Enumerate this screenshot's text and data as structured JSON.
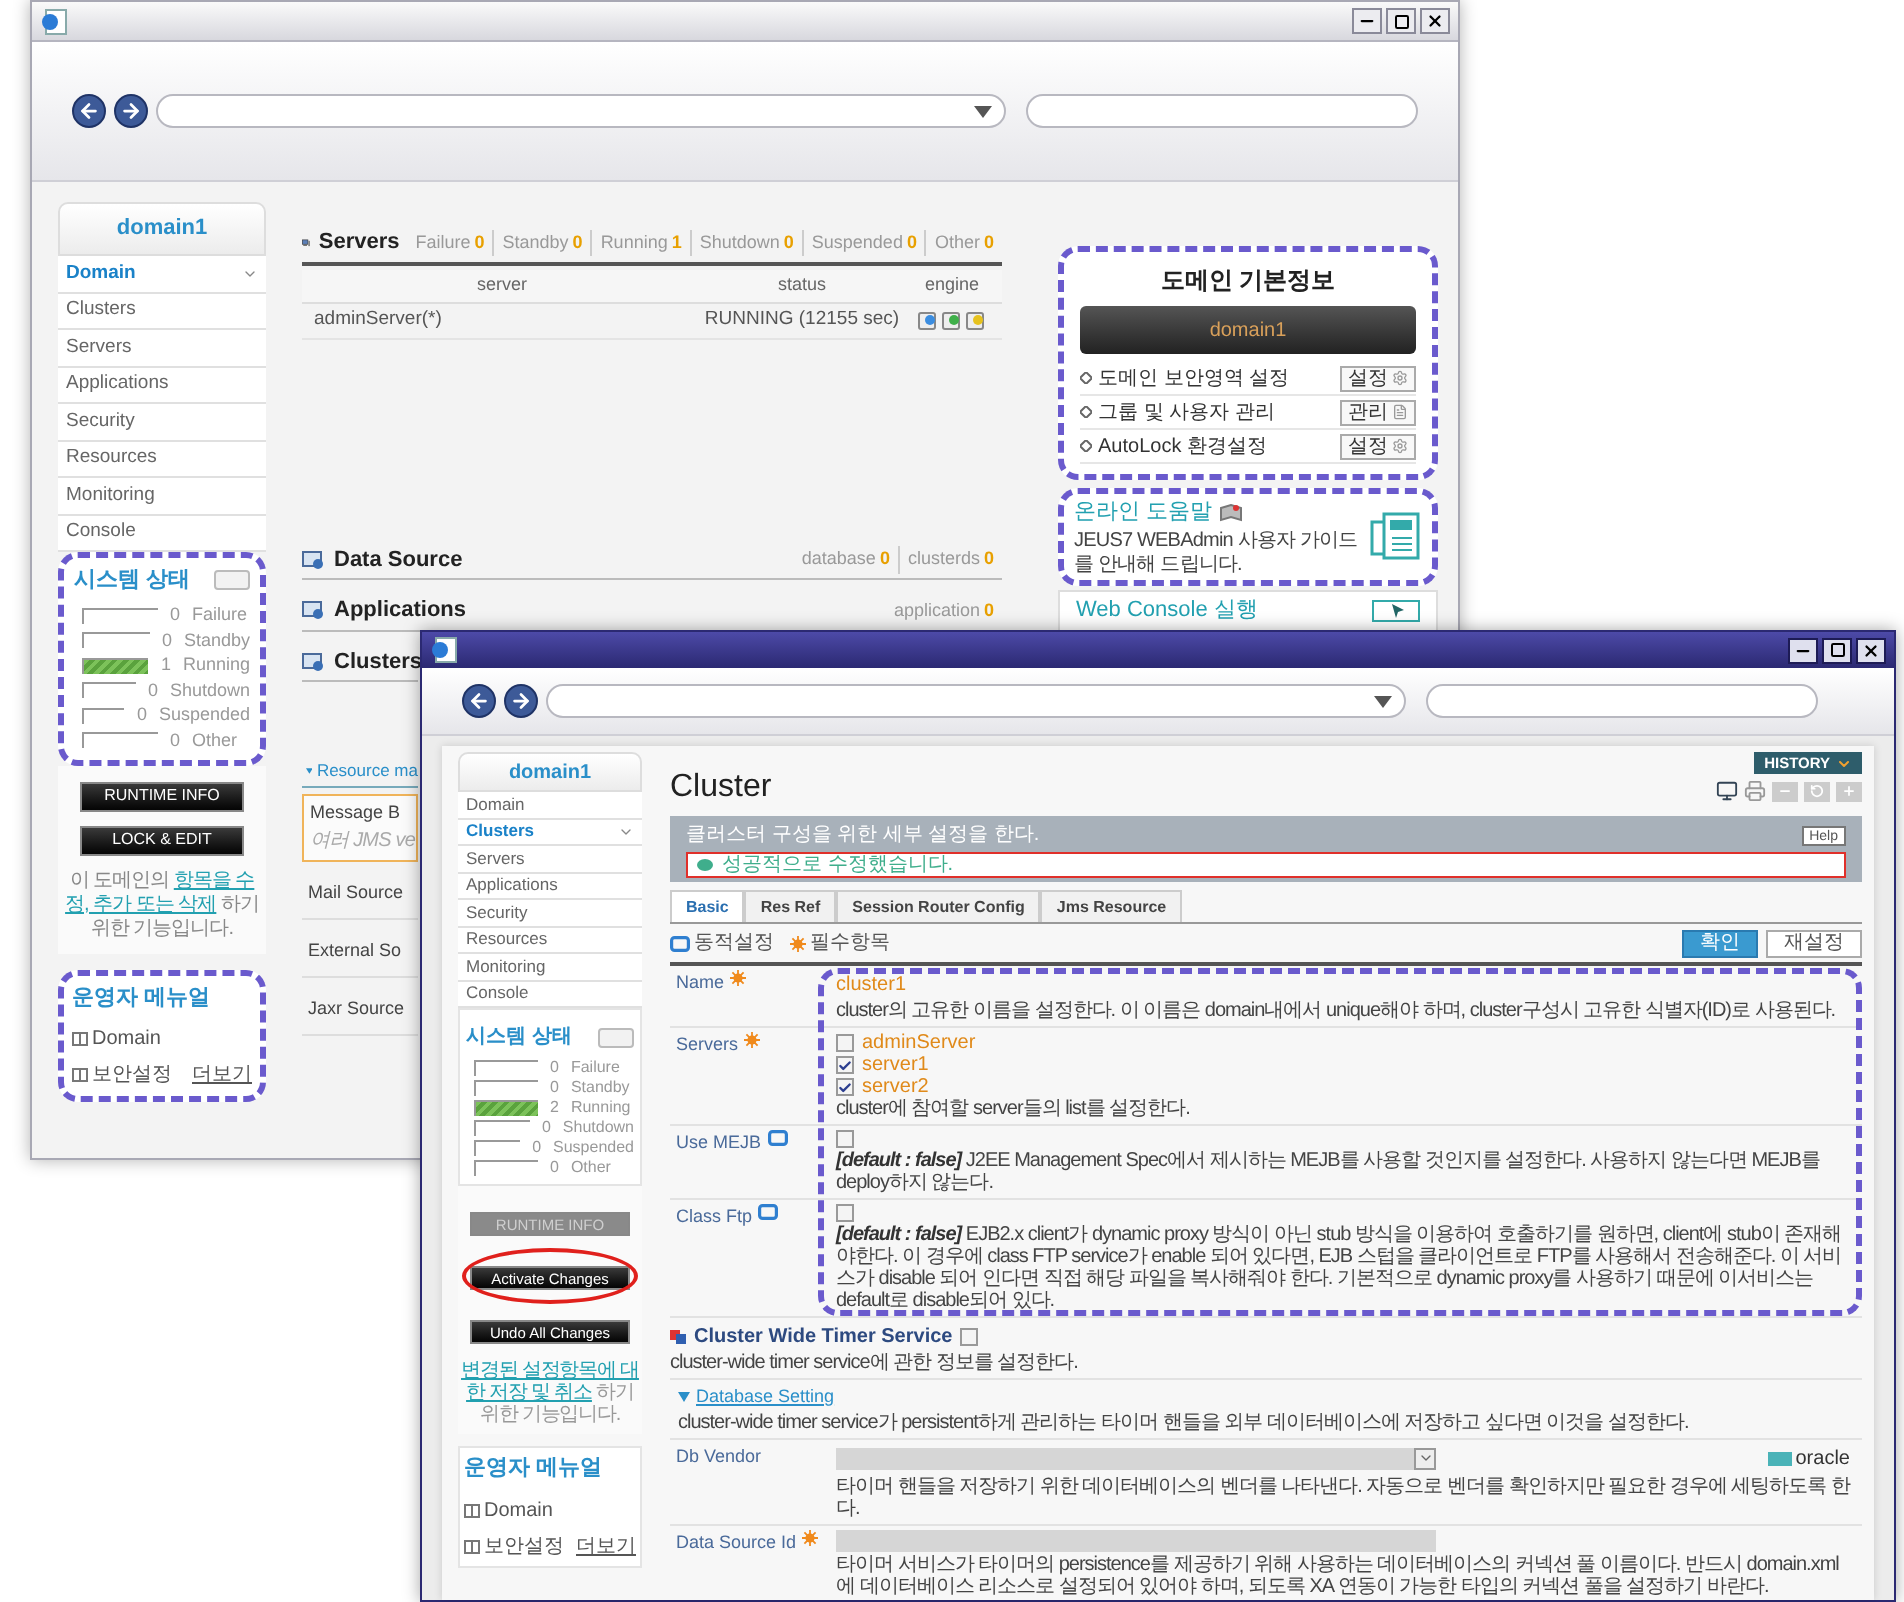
{
  "back_window": {
    "sidebar": {
      "domain": "domain1",
      "items": [
        {
          "label": "Domain",
          "selected": true
        },
        {
          "label": "Clusters",
          "selected": false
        },
        {
          "label": "Servers",
          "selected": false
        },
        {
          "label": "Applications",
          "selected": false
        },
        {
          "label": "Security",
          "selected": false
        },
        {
          "label": "Resources",
          "selected": false
        },
        {
          "label": "Monitoring",
          "selected": false
        },
        {
          "label": "Console",
          "selected": false
        }
      ],
      "status": {
        "title": "시스템 상태",
        "rows": [
          {
            "count": "0",
            "label": "Failure"
          },
          {
            "count": "0",
            "label": "Standby"
          },
          {
            "count": "1",
            "label": "Running",
            "level": 1
          },
          {
            "count": "0",
            "label": "Shutdown"
          },
          {
            "count": "0",
            "label": "Suspended"
          },
          {
            "count": "0",
            "label": "Other"
          }
        ]
      },
      "buttons": [
        "RUNTIME INFO",
        "LOCK & EDIT"
      ],
      "note": {
        "before": "이 도메인의",
        "links": [
          "항목을 수",
          "정, 추가 또는 삭제"
        ],
        "after": "하기 위한 기능입니다."
      },
      "manual": {
        "title": "운영자 메뉴얼",
        "links": [
          "Domain",
          "보안설정"
        ],
        "more": "더보기"
      }
    },
    "servers": {
      "title": "Servers",
      "counts": [
        {
          "label": "Failure",
          "count": "0"
        },
        {
          "label": "Standby",
          "count": "0"
        },
        {
          "label": "Running",
          "count": "1"
        },
        {
          "label": "Shutdown",
          "count": "0"
        },
        {
          "label": "Suspended",
          "count": "0"
        },
        {
          "label": "Other",
          "count": "0"
        }
      ],
      "columns": [
        "server",
        "status",
        "engine"
      ],
      "rows": [
        {
          "server": "adminServer(*)",
          "status": "RUNNING (12155 sec)"
        }
      ]
    },
    "sections": [
      {
        "title": "Data Source",
        "counts": [
          {
            "label": "database",
            "count": "0"
          },
          {
            "label": "clusterds",
            "count": "0"
          }
        ]
      },
      {
        "title": "Applications",
        "counts": [
          {
            "label": "application",
            "count": "0"
          }
        ]
      },
      {
        "title": "Clusters"
      }
    ],
    "resources": {
      "title": "Resource ma",
      "items": [
        {
          "title": "Message B",
          "subtitle": "여러 JMS ve",
          "selected": true
        },
        {
          "title": "Mail Source",
          "selected": false
        },
        {
          "title": "External So",
          "selected": false
        },
        {
          "title": "Jaxr Source",
          "selected": false
        }
      ]
    },
    "domain_info": {
      "title": "도메인 기본정보",
      "name": "domain1",
      "rows": [
        {
          "label": "도메인 보안영역 설정",
          "button": "설정",
          "kind": "settings"
        },
        {
          "label": "그룹 및 사용자 관리",
          "button": "관리",
          "kind": "document"
        },
        {
          "label": "AutoLock 환경설정",
          "button": "설정",
          "kind": "settings"
        }
      ]
    },
    "help": {
      "title": "온라인 도움말",
      "text": "JEUS7 WEBAdmin 사용자 가이드를 안내해 드립니다."
    },
    "web_console": "Web Console 실행"
  },
  "front_window": {
    "sidebar": {
      "domain": "domain1",
      "items": [
        {
          "label": "Domain",
          "selected": false
        },
        {
          "label": "Clusters",
          "selected": true
        },
        {
          "label": "Servers",
          "selected": false
        },
        {
          "label": "Applications",
          "selected": false
        },
        {
          "label": "Security",
          "selected": false
        },
        {
          "label": "Resources",
          "selected": false
        },
        {
          "label": "Monitoring",
          "selected": false
        },
        {
          "label": "Console",
          "selected": false
        }
      ],
      "status": {
        "title": "시스템 상태",
        "rows": [
          {
            "count": "0",
            "label": "Failure"
          },
          {
            "count": "0",
            "label": "Standby"
          },
          {
            "count": "2",
            "label": "Running",
            "level": 1
          },
          {
            "count": "0",
            "label": "Shutdown"
          },
          {
            "count": "0",
            "label": "Suspended"
          },
          {
            "count": "0",
            "label": "Other"
          }
        ]
      },
      "buttons": [
        {
          "label": "RUNTIME INFO",
          "disabled": true,
          "circled": false
        },
        {
          "label": "Activate Changes",
          "disabled": false,
          "circled": true
        },
        {
          "label": "Undo All Changes",
          "disabled": false,
          "circled": false
        }
      ],
      "note": {
        "links": [
          "변경된 설정항목에 대",
          "한 저장 및 취소"
        ],
        "after": "하기 위한 기능입니다."
      },
      "manual": {
        "title": "운영자 메뉴얼",
        "links": [
          "Domain",
          "보안설정"
        ],
        "more": "더보기"
      }
    },
    "title": "Cluster",
    "history": "HISTORY",
    "banner": {
      "text": "클러스터 구성을 위한 세부 설정을 한다.",
      "message": "성공적으로 수정했습니다.",
      "help": "Help"
    },
    "tabs": [
      {
        "label": "Basic",
        "selected": true
      },
      {
        "label": "Res Ref",
        "selected": false
      },
      {
        "label": "Session Router Config",
        "selected": false
      },
      {
        "label": "Jms Resource",
        "selected": false
      }
    ],
    "legend": [
      {
        "kind": "dynamic",
        "label": "동적설정"
      },
      {
        "kind": "required",
        "label": "필수항목"
      }
    ],
    "actions": [
      "확인",
      "재설정"
    ],
    "fields": [
      {
        "label": "Name",
        "required": true,
        "dynamic": false,
        "kind": "text",
        "value": "cluster1",
        "description": "cluster의 고유한 이름을 설정한다. 이 이름은 domain내에서 unique해야 하며, cluster구성시 고유한 식별자(ID)로 사용된다."
      },
      {
        "label": "Servers",
        "required": true,
        "dynamic": false,
        "kind": "checklist",
        "options": [
          {
            "label": "adminServer",
            "checked": false
          },
          {
            "label": "server1",
            "checked": true
          },
          {
            "label": "server2",
            "checked": true
          }
        ],
        "description": "cluster에 참여할 server들의 list를 설정한다."
      },
      {
        "label": "Use MEJB",
        "required": false,
        "dynamic": true,
        "kind": "checkbox",
        "checked": false,
        "default": "[default : false]",
        "description": "J2EE Management Spec에서 제시하는 MEJB를 사용할 것인지를 설정한다. 사용하지 않는다면 MEJB를 deploy하지 않는다."
      },
      {
        "label": "Class Ftp",
        "required": false,
        "dynamic": true,
        "kind": "checkbox",
        "checked": false,
        "default": "[default : false]",
        "description": "EJB2.x client가 dynamic proxy 방식이 아닌 stub 방식을 이용하여 호출하기를 원하면, client에 stub이 존재해야한다. 이 경우에 class FTP service가 enable 되어 있다면, EJB 스텁을 클라이언트로 FTP를 사용해서 전송해준다. 이 서비스가 disable 되어 인다면 직접 해당 파일을 복사해줘야 한다. 기본적으로 dynamic proxy를 사용하기 때문에 이서비스는 default로 disable되어 있다."
      }
    ],
    "timer": {
      "title": "Cluster Wide Timer Service",
      "checked": false,
      "description": "cluster-wide timer service에 관한 정보를 설정한다."
    },
    "database": {
      "title": "Database Setting",
      "description": "cluster-wide timer service가 persistent하게 관리하는 타이머 핸들을 외부 데이터베이스에 저장하고 싶다면 이것을 설정한다.",
      "fields": [
        {
          "label": "Db Vendor",
          "required": false,
          "dynamic": false,
          "kind": "select",
          "hint": "oracle",
          "description": "타이머 핸들을 저장하기 위한 데이터베이스의 벤더를 나타낸다. 자동으로 벤더를 확인하지만 필요한 경우에 세팅하도록 한다."
        },
        {
          "label": "Data Source Id",
          "required": true,
          "dynamic": false,
          "kind": "input",
          "description": "타이머 서비스가 타이머의 persistence를 제공하기 위해 사용하는 데이터베이스의 커넥션 풀 이름이다. 반드시 domain.xml에 데이터베이스 리소스로 설정되어 있어야 하며, 되도록 XA 연동이 가능한 타입의 커넥션 풀을 설정하기 바란다."
        }
      ]
    }
  }
}
